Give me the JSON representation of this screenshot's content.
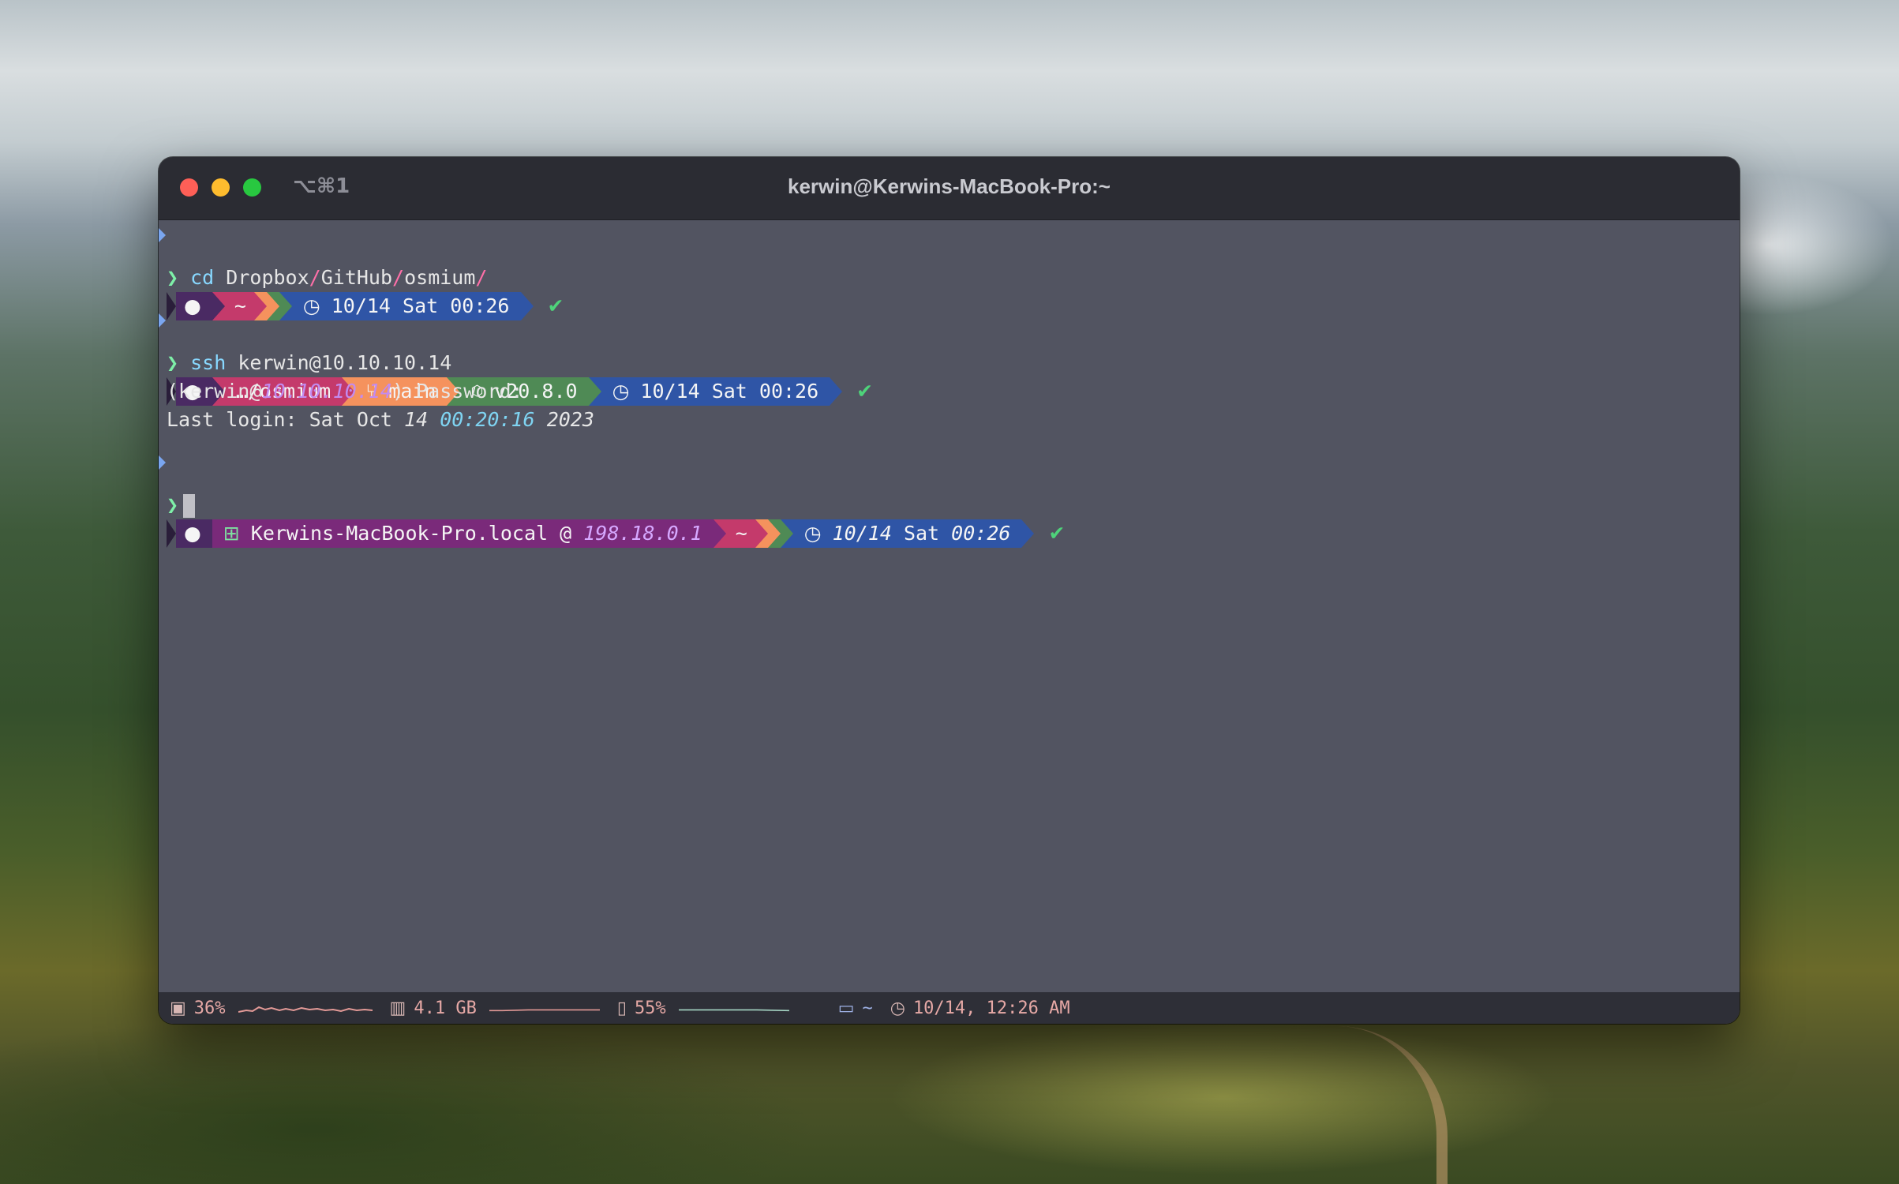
{
  "window": {
    "tab_shortcut": "⌥⌘1",
    "title": "kerwin@Kerwins-MacBook-Pro:~"
  },
  "prompt1": {
    "apple_icon": "apple-icon",
    "dir": "~",
    "clock_icon": "clock-icon",
    "time": "10/14 Sat 00:26",
    "status": "✔"
  },
  "cmd1": {
    "prompt": "❯",
    "command": "cd",
    "arg_parts": [
      "Dropbox",
      "/",
      "GitHub",
      "/",
      "osmium",
      "/"
    ]
  },
  "prompt2": {
    "dir": "…/osmium",
    "git_icon": "git-branch-icon",
    "branch": "main",
    "node_icon": "nodejs-icon",
    "node_version": "v20.8.0",
    "time": "10/14 Sat 00:26",
    "status": "✔"
  },
  "cmd2": {
    "prompt": "❯",
    "command": "ssh",
    "arg": "kerwin@10.10.10.14"
  },
  "output": {
    "password_pre": "(kerwin@",
    "password_ip": "10.10.10.14",
    "password_post": ") Password:",
    "login_pre": "Last login: Sat Oct ",
    "login_day": "14",
    "login_time": "00:20:16",
    "login_year": "2023"
  },
  "prompt3": {
    "host_icon": "network-icon",
    "host": "Kerwins-MacBook-Pro.local @ ",
    "ip": "198.18.0.1",
    "dir": "~",
    "time_date": "10/14",
    "time_day": "Sat",
    "time_clock": "00:26",
    "status": "✔"
  },
  "cmd3": {
    "prompt": "❯"
  },
  "statusbar": {
    "cpu_icon": "cpu-icon",
    "cpu": "36%",
    "mem_icon": "memory-icon",
    "mem": "4.1 GB",
    "battery_icon": "battery-icon",
    "battery": "55%",
    "folder_icon": "folder-icon",
    "folder": "~",
    "clock_icon": "clock-icon",
    "datetime": "10/14, 12:26 AM"
  },
  "colors": {
    "seg_dark_purple": "#4a2a63",
    "seg_purple": "#7a2a7a",
    "seg_pink": "#c43a6b",
    "seg_orange": "#f5925d",
    "seg_green": "#4f8a55",
    "seg_blue": "#2f55a6",
    "terminal_bg": "#525461"
  }
}
